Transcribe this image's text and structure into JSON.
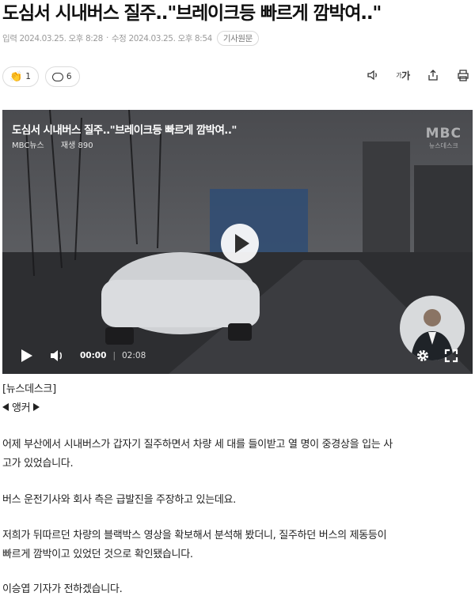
{
  "article": {
    "headline": "도심서 시내버스 질주..\"브레이크등 빠르게 깜박여..\"",
    "input_label": "입력",
    "input_date": "2024.03.25. 오후 8:28",
    "edit_label": "수정",
    "edit_date": "2024.03.25. 오후 8:54",
    "original_button": "기사원문"
  },
  "reactions": {
    "like_count": "1",
    "comment_count": "6"
  },
  "toolbar": {
    "font_size_label_small": "가",
    "font_size_label": "가"
  },
  "video": {
    "title": "도심서 시내버스 질주..\"브레이크등 빠르게 깜박여..\"",
    "channel": "MBC뉴스",
    "view_label": "재생 890",
    "logo_top": "MBC",
    "logo_bottom": "뉴스데스크",
    "current_time": "00:00",
    "total_time": "02:08"
  },
  "body": {
    "program": "[뉴스데스크]",
    "anchor_label": "앵커",
    "p1_line1": "어제 부산에서 시내버스가 갑자기 질주하면서 차량 세 대를 들이받고 열 명이 중경상을 입는 사",
    "p1_line2": "고가 있었습니다.",
    "p2": "버스 운전기사와 회사 측은 급발진을 주장하고 있는데요.",
    "p3_line1": "저희가 뒤따르던 차량의 블랙박스 영상을 확보해서 분석해 봤더니, 질주하던 버스의 제동등이",
    "p3_line2": "빠르게 깜박이고 있었던 것으로 확인됐습니다.",
    "p4": "이승엽 기자가 전하겠습니다."
  },
  "colors": {
    "accent_clap": "#f2b400",
    "meta_text": "#9a9a9a",
    "video_bg": "#2a2b2e"
  }
}
